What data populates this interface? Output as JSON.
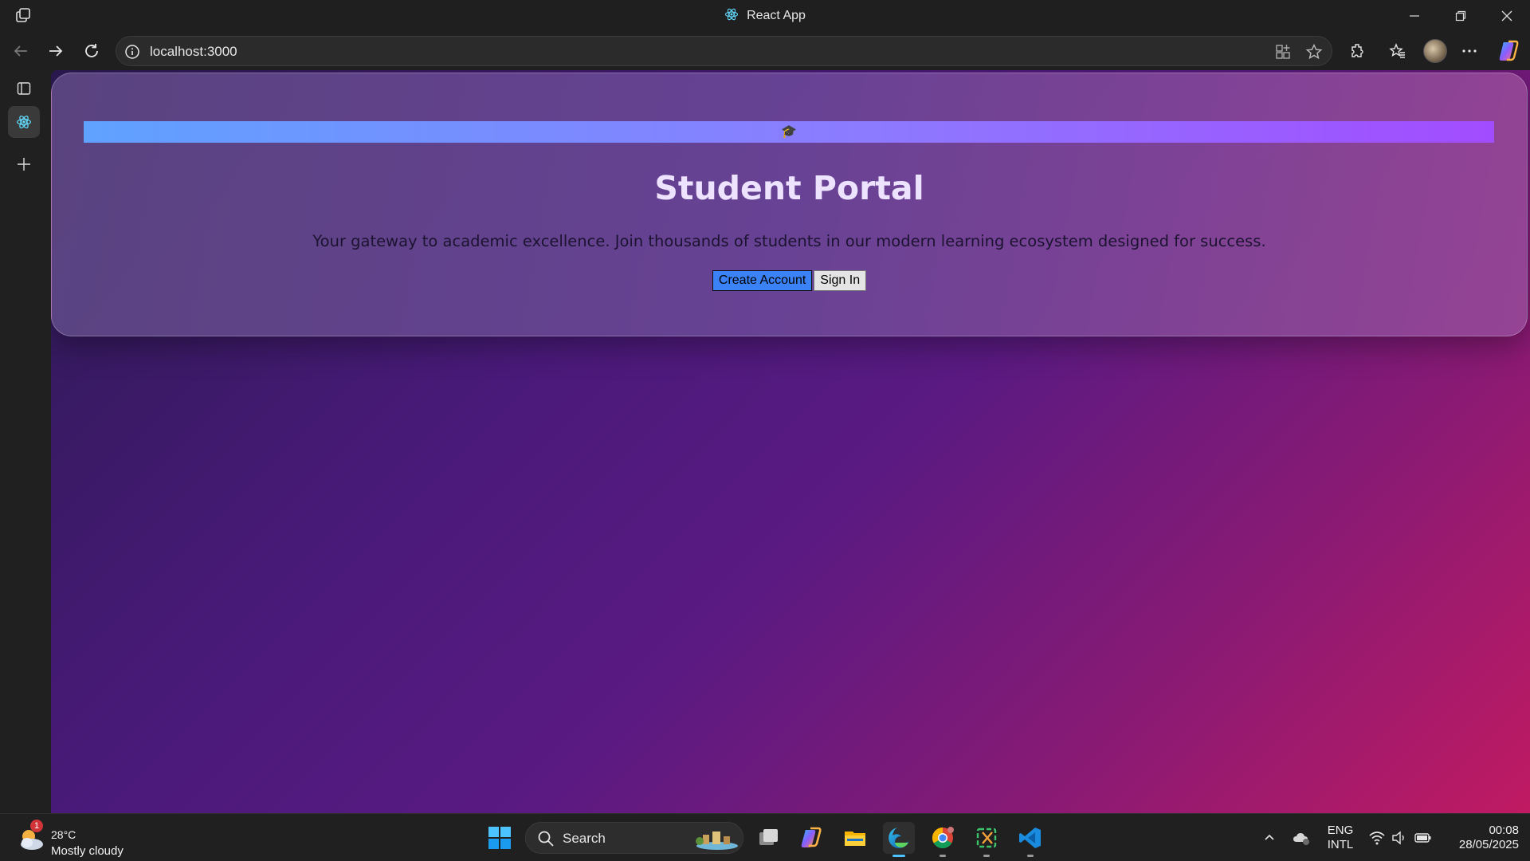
{
  "window": {
    "title": "React App"
  },
  "address_bar": {
    "url": "localhost:3000"
  },
  "page": {
    "hero_icon": "🎓",
    "title": "Student Portal",
    "subtitle": "Your gateway to academic excellence. Join thousands of students in our modern learning ecosystem designed for success.",
    "primary_button": "Create Account",
    "secondary_button": "Sign In"
  },
  "taskbar": {
    "weather_temp": "28°C",
    "weather_desc": "Mostly cloudy",
    "weather_badge": "1",
    "search_placeholder": "Search",
    "lang_line1": "ENG",
    "lang_line2": "INTL",
    "time": "00:08",
    "date": "28/05/2025"
  },
  "colors": {
    "accent_blue": "#3b82f6",
    "gradient_start": "#2b1a52",
    "gradient_end": "#c01a62"
  }
}
